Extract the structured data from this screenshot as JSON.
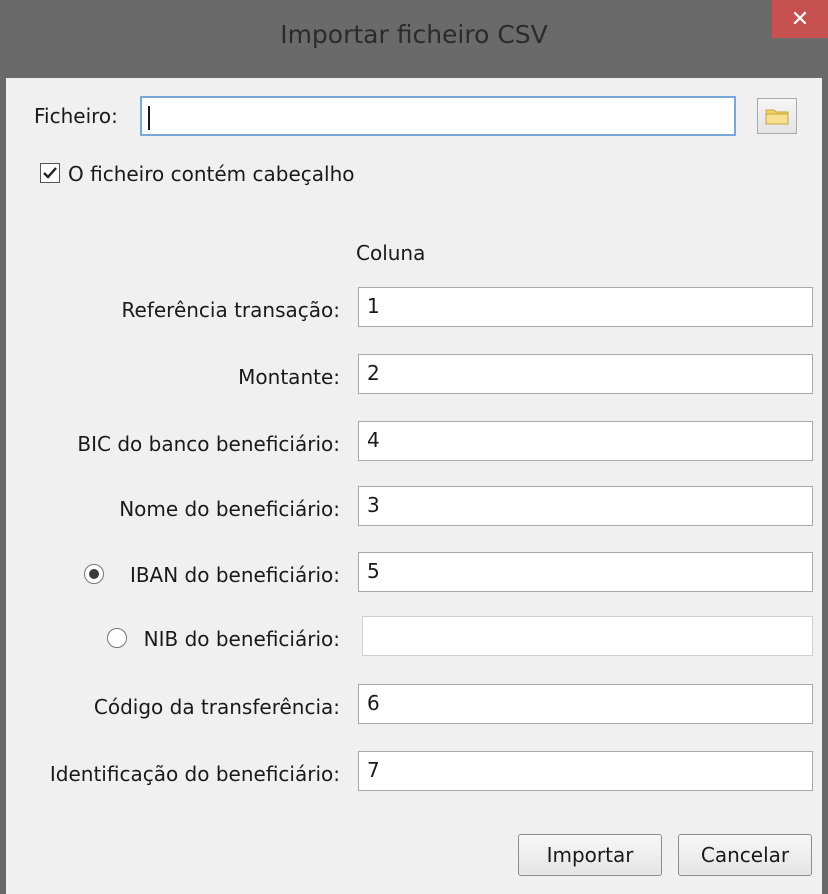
{
  "window": {
    "title": "Importar ficheiro CSV",
    "close_glyph": "✕"
  },
  "file": {
    "label": "Ficheiro:",
    "value": ""
  },
  "header_checkbox": {
    "label": "O ficheiro contém cabeçalho",
    "checked": true
  },
  "column_header": "Coluna",
  "fields": {
    "referencia": {
      "label": "Referência transação:",
      "value": "1"
    },
    "montante": {
      "label": "Montante:",
      "value": "2"
    },
    "bic": {
      "label": "BIC do banco beneficiário:",
      "value": "4"
    },
    "nome": {
      "label": "Nome do beneficiário:",
      "value": "3"
    },
    "iban": {
      "label": "IBAN do beneficiário:",
      "value": "5",
      "selected": true
    },
    "nib": {
      "label": "NIB do beneficiário:",
      "value": "",
      "selected": false
    },
    "codigo": {
      "label": "Código da transferência:",
      "value": "6"
    },
    "identificacao": {
      "label": "Identificação do beneficiário:",
      "value": "7"
    }
  },
  "buttons": {
    "import": "Importar",
    "cancel": "Cancelar"
  },
  "icons": {
    "browse": "folder-icon",
    "close": "close-icon"
  }
}
